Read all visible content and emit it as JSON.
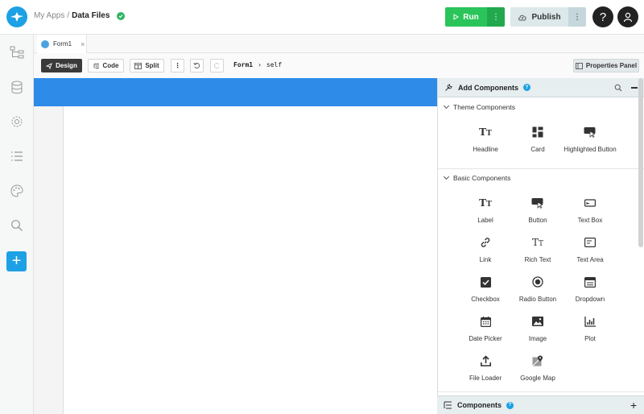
{
  "header": {
    "breadcrumb_root": "My Apps",
    "breadcrumb_sep": "/",
    "app_name": "Data Files",
    "run_label": "Run",
    "more_glyph": "⋮",
    "publish_label": "Publish",
    "help_glyph": "?"
  },
  "tabs": [
    {
      "label": "Form1",
      "close": "×"
    }
  ],
  "toolbar": {
    "design_label": "Design",
    "code_label": "Code",
    "split_label": "Split",
    "more_glyph": "⋮",
    "form_crumb": "Form1",
    "crumb_arrow": "›",
    "self_crumb": "self",
    "properties_label": "Properties Panel"
  },
  "colors": {
    "accent": "#1da1e4",
    "run": "#2ac45a",
    "canvas_band": "#2e8be8"
  },
  "add_panel": {
    "title": "Add Components",
    "help": "?",
    "theme_title": "Theme Components",
    "theme_items": [
      {
        "label": "Headline",
        "icon": "text-icon"
      },
      {
        "label": "Card",
        "icon": "card-icon"
      },
      {
        "label": "Highlighted Button",
        "icon": "button-icon"
      }
    ],
    "basic_title": "Basic Components",
    "basic_items": [
      {
        "label": "Label",
        "icon": "text-icon"
      },
      {
        "label": "Button",
        "icon": "button-icon"
      },
      {
        "label": "Text Box",
        "icon": "textbox-icon"
      },
      {
        "label": "Link",
        "icon": "link-icon"
      },
      {
        "label": "Rich Text",
        "icon": "text-icon"
      },
      {
        "label": "Text Area",
        "icon": "textarea-icon"
      },
      {
        "label": "Checkbox",
        "icon": "checkbox-icon"
      },
      {
        "label": "Radio Button",
        "icon": "radio-icon"
      },
      {
        "label": "Dropdown",
        "icon": "dropdown-icon"
      },
      {
        "label": "Date Picker",
        "icon": "calendar-icon"
      },
      {
        "label": "Image",
        "icon": "image-icon"
      },
      {
        "label": "Plot",
        "icon": "plot-icon"
      },
      {
        "label": "File Loader",
        "icon": "upload-icon"
      },
      {
        "label": "Google Map",
        "icon": "map-icon"
      }
    ]
  },
  "components_panel": {
    "title": "Components",
    "help": "?",
    "add": "+"
  }
}
